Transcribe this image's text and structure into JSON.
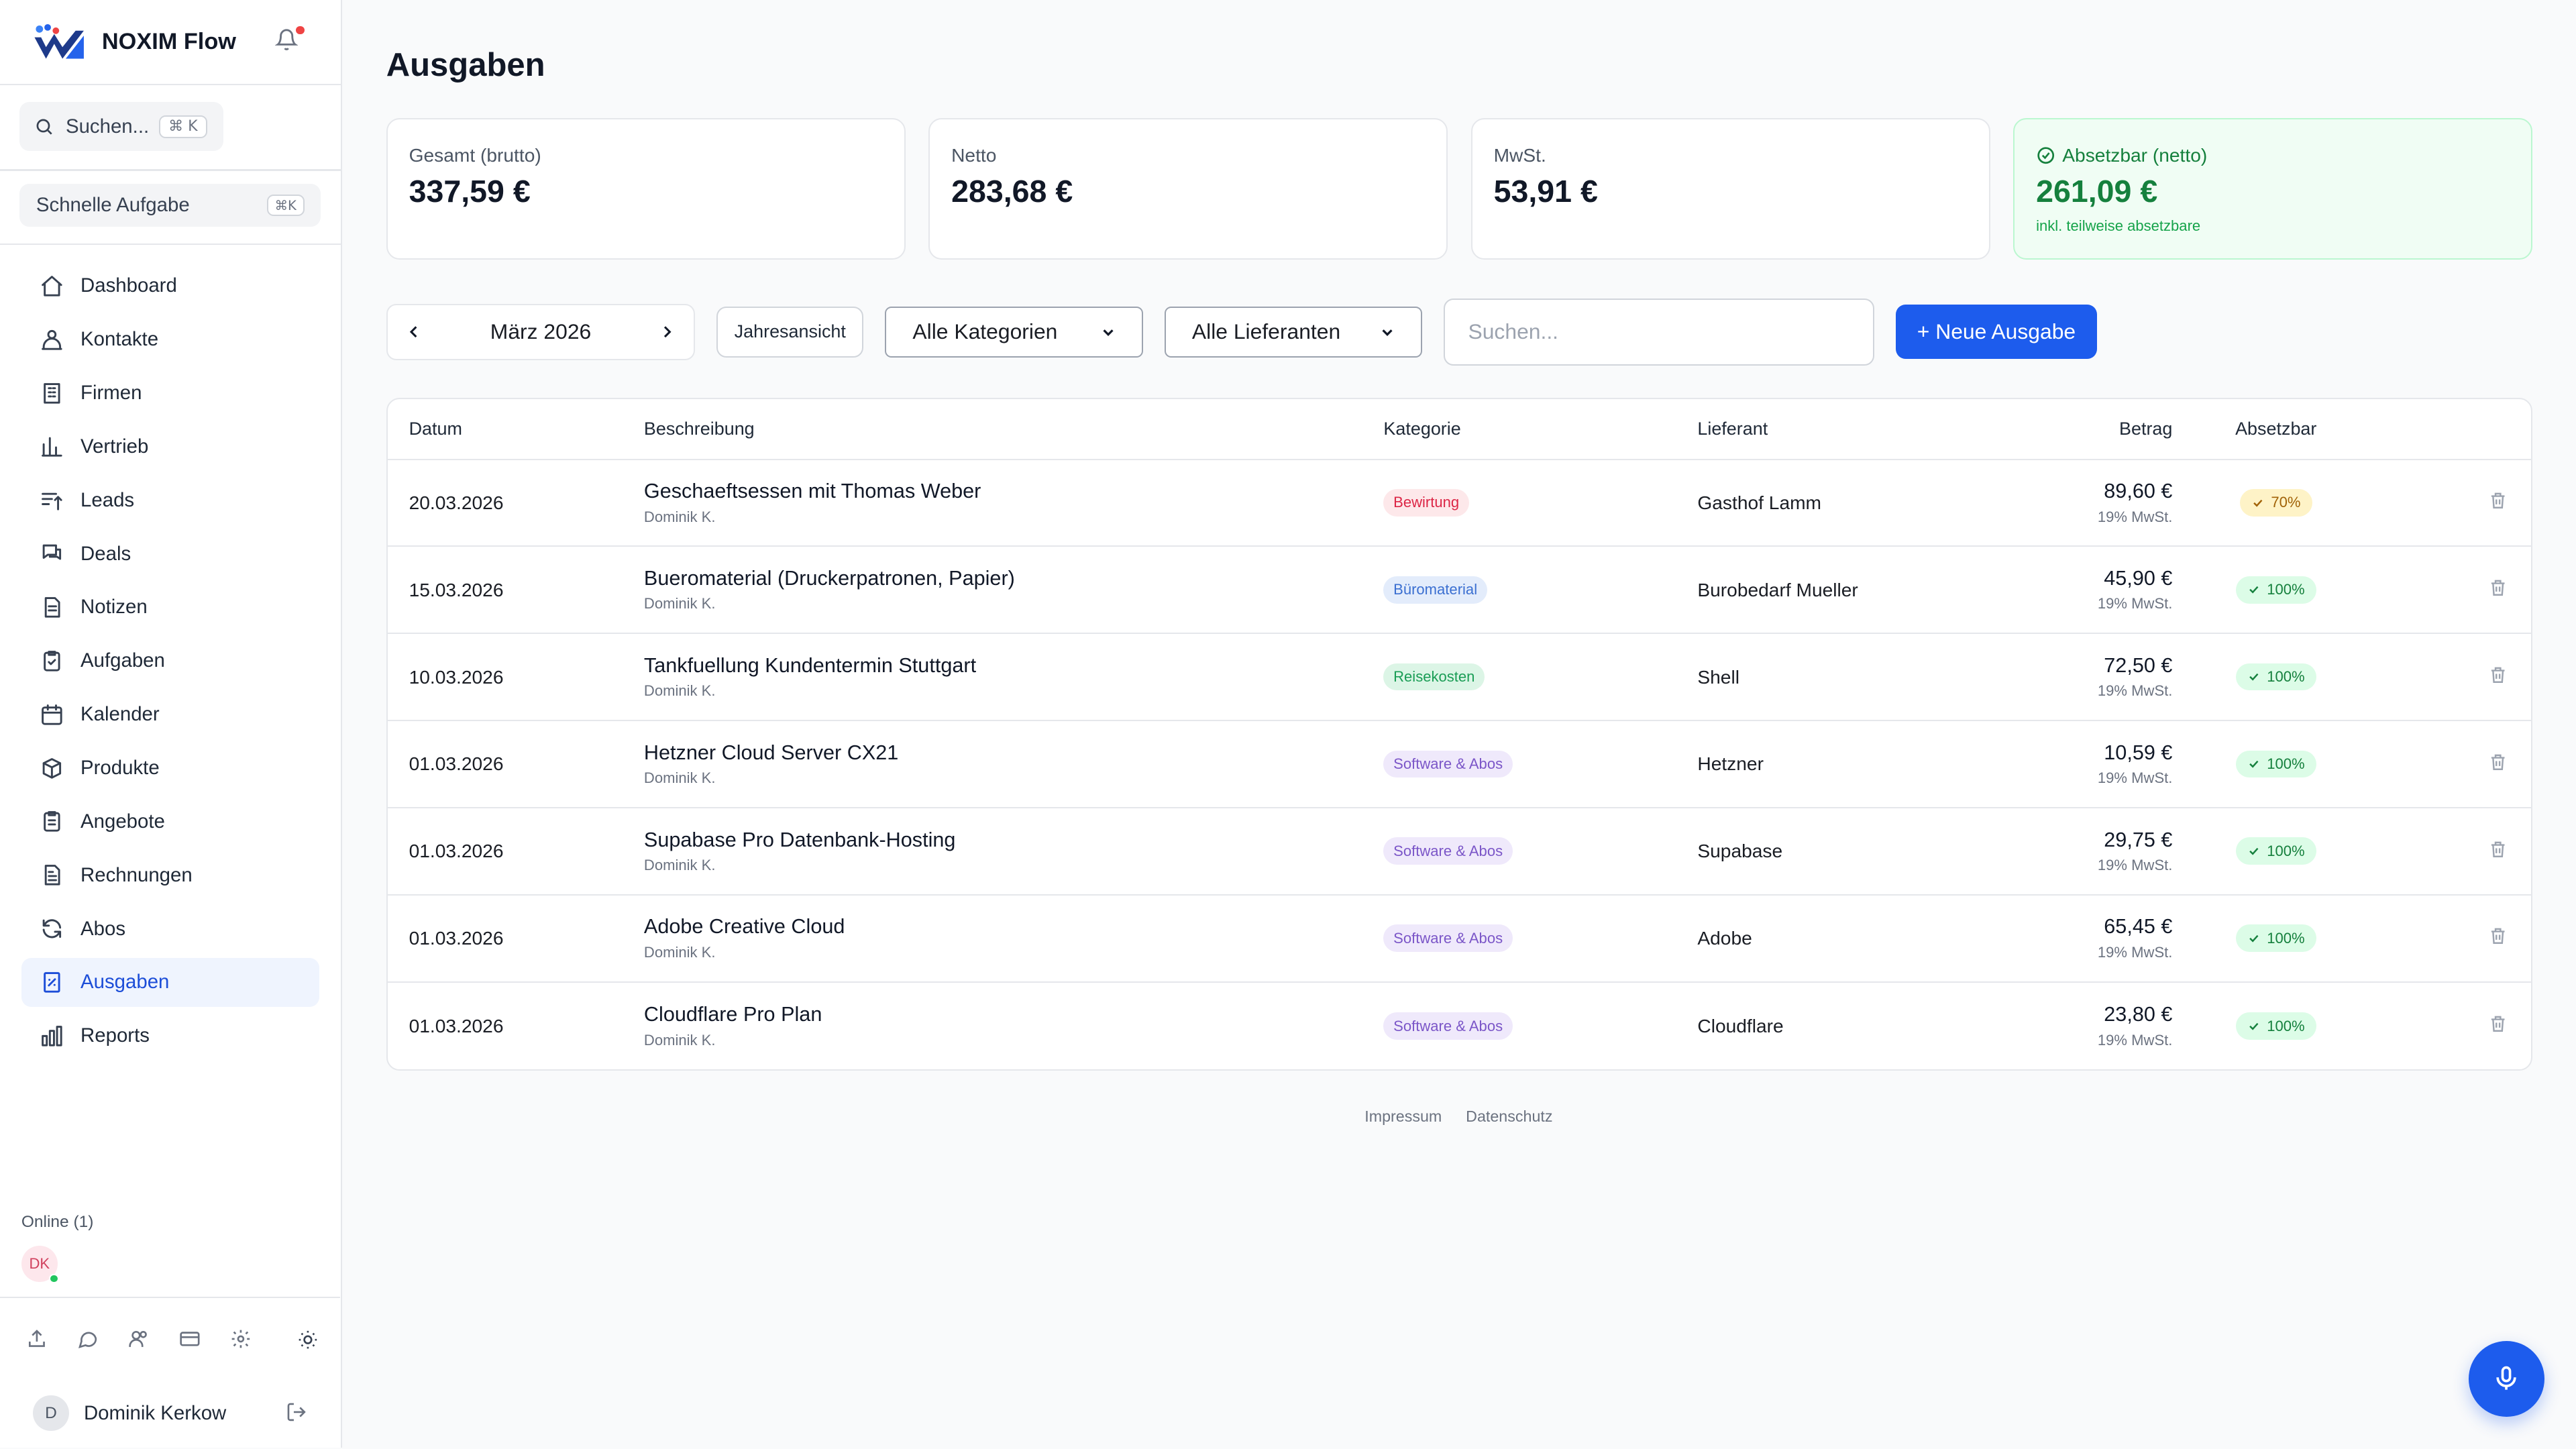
{
  "app": {
    "name": "NOXIM Flow"
  },
  "sidebar": {
    "search": {
      "label": "Suchen...",
      "shortcut": "⌘ K"
    },
    "quick": {
      "label": "Schnelle Aufgabe",
      "shortcut": "⌘K"
    },
    "items": [
      {
        "label": "Dashboard",
        "icon": "home-icon"
      },
      {
        "label": "Kontakte",
        "icon": "contacts-icon"
      },
      {
        "label": "Firmen",
        "icon": "building-icon"
      },
      {
        "label": "Vertrieb",
        "icon": "chart-icon"
      },
      {
        "label": "Leads",
        "icon": "leads-icon"
      },
      {
        "label": "Deals",
        "icon": "chat-icon"
      },
      {
        "label": "Notizen",
        "icon": "note-icon"
      },
      {
        "label": "Aufgaben",
        "icon": "clipboard-check-icon"
      },
      {
        "label": "Kalender",
        "icon": "calendar-icon"
      },
      {
        "label": "Produkte",
        "icon": "box-icon"
      },
      {
        "label": "Angebote",
        "icon": "clipboard-icon"
      },
      {
        "label": "Rechnungen",
        "icon": "invoice-icon"
      },
      {
        "label": "Abos",
        "icon": "refresh-icon"
      },
      {
        "label": "Ausgaben",
        "icon": "receipt-icon",
        "active": true
      },
      {
        "label": "Reports",
        "icon": "report-icon"
      }
    ],
    "online": {
      "label": "Online (1)",
      "avatar": "DK"
    },
    "user": {
      "initial": "D",
      "name": "Dominik Kerkow"
    }
  },
  "page": {
    "title": "Ausgaben"
  },
  "cards": [
    {
      "label": "Gesamt (brutto)",
      "value": "337,59 €"
    },
    {
      "label": "Netto",
      "value": "283,68 €"
    },
    {
      "label": "MwSt.",
      "value": "53,91 €"
    },
    {
      "label": "Absetzbar (netto)",
      "value": "261,09 €",
      "sub": "inkl. teilweise absetzbare"
    }
  ],
  "filters": {
    "month": "März 2026",
    "year_view": "Jahresansicht",
    "category": "Alle Kategorien",
    "supplier": "Alle Lieferanten",
    "search_placeholder": "Suchen...",
    "new_button": "+ Neue Ausgabe"
  },
  "table": {
    "headers": [
      "Datum",
      "Beschreibung",
      "Kategorie",
      "Lieferant",
      "Betrag",
      "Absetzbar"
    ],
    "rows": [
      {
        "date": "20.03.2026",
        "title": "Geschaeftsessen mit Thomas Weber",
        "user": "Dominik K.",
        "category": "Bewirtung",
        "supplier": "Gasthof Lamm",
        "amount": "89,60 €",
        "vat": "19% MwSt.",
        "deductible": "70%"
      },
      {
        "date": "15.03.2026",
        "title": "Bueromaterial (Druckerpatronen, Papier)",
        "user": "Dominik K.",
        "category": "Büromaterial",
        "supplier": "Burobedarf Mueller",
        "amount": "45,90 €",
        "vat": "19% MwSt.",
        "deductible": "100%"
      },
      {
        "date": "10.03.2026",
        "title": "Tankfuellung Kundentermin Stuttgart",
        "user": "Dominik K.",
        "category": "Reisekosten",
        "supplier": "Shell",
        "amount": "72,50 €",
        "vat": "19% MwSt.",
        "deductible": "100%"
      },
      {
        "date": "01.03.2026",
        "title": "Hetzner Cloud Server CX21",
        "user": "Dominik K.",
        "category": "Software & Abos",
        "supplier": "Hetzner",
        "amount": "10,59 €",
        "vat": "19% MwSt.",
        "deductible": "100%"
      },
      {
        "date": "01.03.2026",
        "title": "Supabase Pro Datenbank-Hosting",
        "user": "Dominik K.",
        "category": "Software & Abos",
        "supplier": "Supabase",
        "amount": "29,75 €",
        "vat": "19% MwSt.",
        "deductible": "100%"
      },
      {
        "date": "01.03.2026",
        "title": "Adobe Creative Cloud",
        "user": "Dominik K.",
        "category": "Software & Abos",
        "supplier": "Adobe",
        "amount": "65,45 €",
        "vat": "19% MwSt.",
        "deductible": "100%"
      },
      {
        "date": "01.03.2026",
        "title": "Cloudflare Pro Plan",
        "user": "Dominik K.",
        "category": "Software & Abos",
        "supplier": "Cloudflare",
        "amount": "23,80 €",
        "vat": "19% MwSt.",
        "deductible": "100%"
      }
    ]
  },
  "category_colors": {
    "Bewirtung": {
      "bg": "#fde8ea",
      "fg": "#dc2646"
    },
    "Büromaterial": {
      "bg": "#e3ecfb",
      "fg": "#3b6fd1"
    },
    "Reisekosten": {
      "bg": "#dcf5e6",
      "fg": "#1a9d55"
    },
    "Software & Abos": {
      "bg": "#efe9fb",
      "fg": "#7b56c8"
    }
  },
  "footer": {
    "links": [
      "Impressum",
      "Datenschutz"
    ]
  },
  "colors": {
    "primary": "#1d5ced",
    "success": "#15803d"
  }
}
